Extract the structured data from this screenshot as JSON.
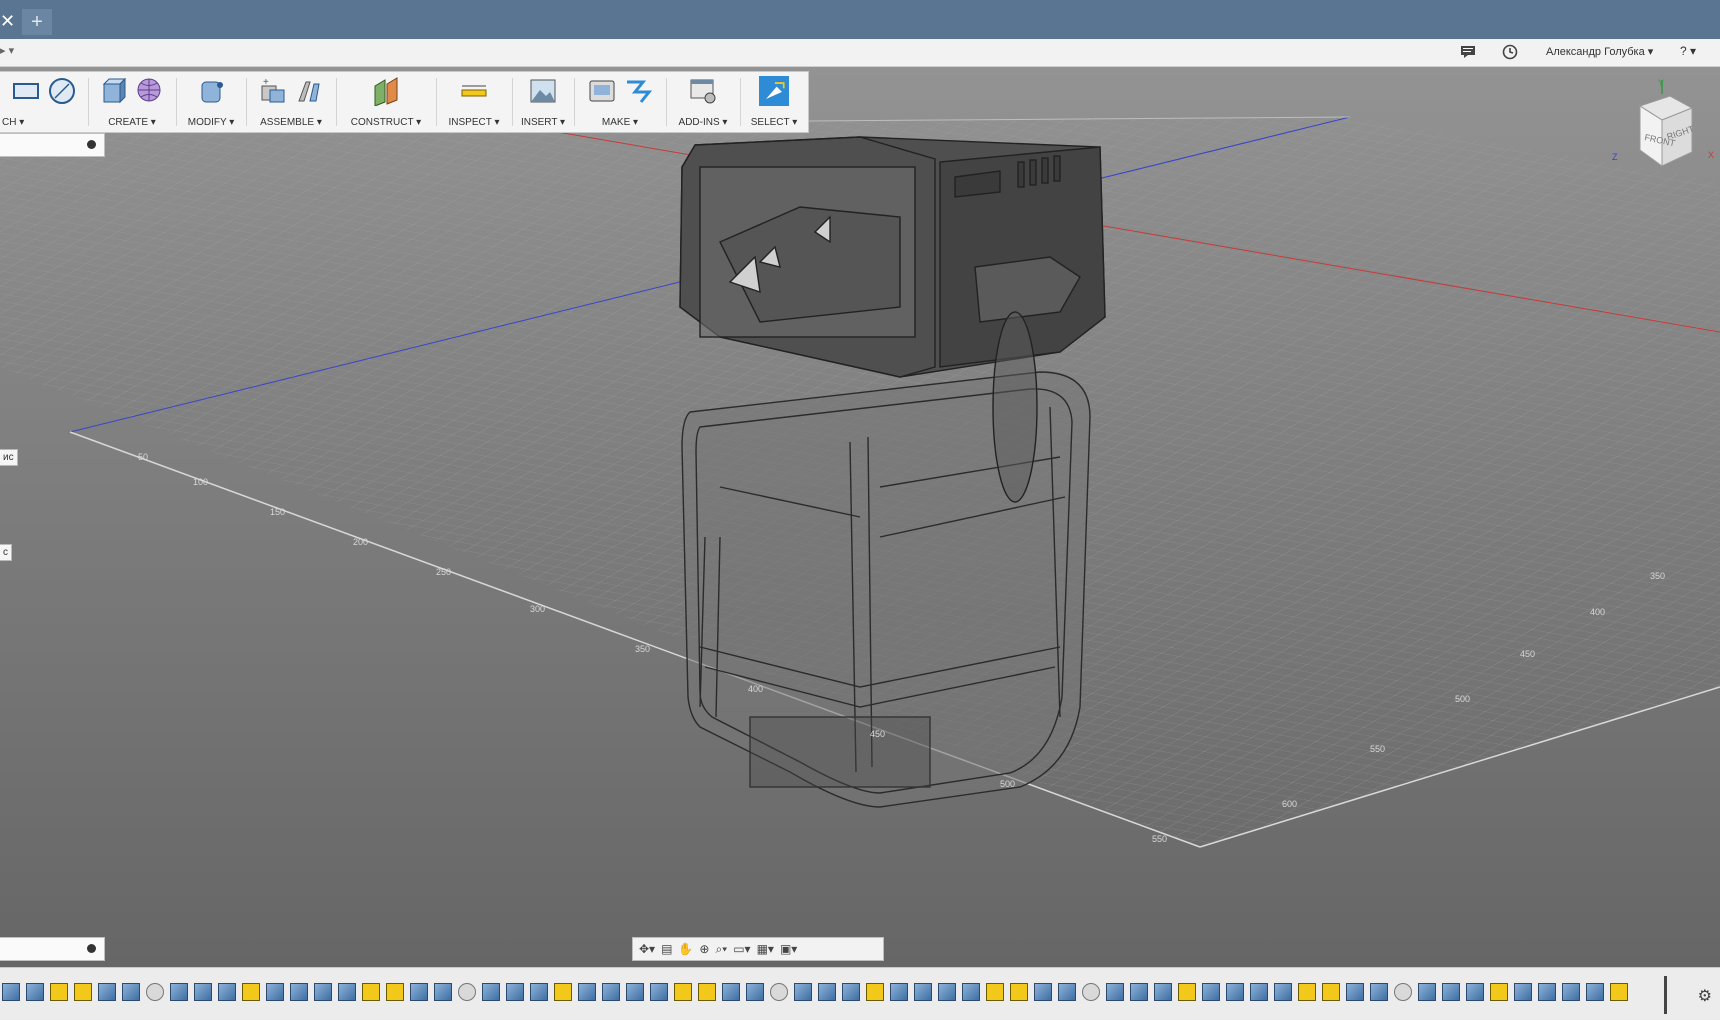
{
  "tabs": {
    "close_symbol": "✕",
    "new_symbol": "+"
  },
  "appbar": {
    "nav_symbol": "▸ ▾",
    "user_name": "Александр Голубка ▾",
    "help_symbol": "? ▾"
  },
  "toolbar": {
    "groups": [
      {
        "label": "CH ▾"
      },
      {
        "label": "CREATE ▾"
      },
      {
        "label": "MODIFY ▾"
      },
      {
        "label": "ASSEMBLE ▾"
      },
      {
        "label": "CONSTRUCT ▾"
      },
      {
        "label": "INSPECT ▾"
      },
      {
        "label": "INSERT ▾"
      },
      {
        "label": "MAKE ▾"
      },
      {
        "label": "ADD-INS ▾"
      },
      {
        "label": "SELECT ▾"
      }
    ]
  },
  "side_labels": {
    "left1": "ис",
    "left2": "с"
  },
  "viewcube": {
    "front": "FRONT",
    "right": "RIGHT",
    "x": "X",
    "y": "Y",
    "z": "Z"
  },
  "grid_labels": {
    "left_axis": [
      "50",
      "100",
      "150",
      "200",
      "250",
      "300",
      "350",
      "400",
      "450",
      "500",
      "550"
    ],
    "right_axis": [
      "350",
      "400",
      "450",
      "500",
      "550",
      "600"
    ]
  },
  "colors": {
    "accent_blue": "#2e8bd6",
    "tabbar": "#597591",
    "sketch_yellow": "#f2c81a"
  }
}
